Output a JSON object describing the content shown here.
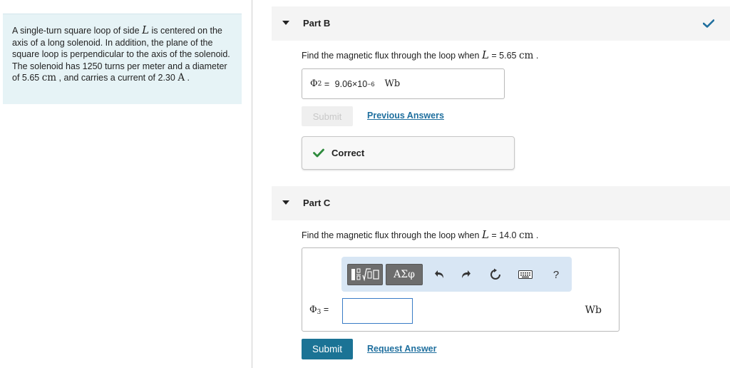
{
  "problem": {
    "t1": "A single-turn square loop of side ",
    "var_L": "L",
    "t2": " is centered on the axis of a long solenoid. In addition, the plane of the square loop is perpendicular to the axis of the solenoid. The solenoid has 1250 turns per meter and a diameter of 5.65 ",
    "unit_cm": "cm",
    "t3": " , and carries a current of 2.30 ",
    "unit_A": "A",
    "t4": " ."
  },
  "partB": {
    "title": "Part B",
    "question_prefix": "Find the magnetic flux through the loop when ",
    "question_var": "L",
    "question_eq": " = 5.65 ",
    "question_unit": "cm",
    "question_end": " .",
    "phi_symbol": "Φ",
    "phi_sub": "2",
    "equals": " = ",
    "answer_mantissa": "9.06×10",
    "answer_exp": "−6",
    "answer_unit": "Wb",
    "submit_label": "Submit",
    "previous_label": "Previous Answers",
    "feedback": "Correct"
  },
  "partC": {
    "title": "Part C",
    "question_prefix": "Find the magnetic flux through the loop when ",
    "question_var": "L",
    "question_eq": " = 14.0 ",
    "question_unit": "cm",
    "question_end": " .",
    "phi_symbol": "Φ",
    "phi_sub": "3",
    "equals": " =",
    "input_value": "",
    "unit": "Wb",
    "toolbar": {
      "templates_icon": "fraction-sqrt-templates-icon",
      "symbols_label": "ΑΣφ",
      "undo_icon": "undo-icon",
      "redo_icon": "redo-icon",
      "reset_icon": "reset-icon",
      "keyboard_icon": "keyboard-icon",
      "help_label": "?"
    },
    "submit_label": "Submit",
    "request_label": "Request Answer"
  },
  "colors": {
    "accent": "#1b7395",
    "link": "#1f6f9e",
    "correct": "#2e8b3d",
    "problem_bg": "#e6f3f6",
    "toolbar_bg": "#d8e6f4"
  }
}
